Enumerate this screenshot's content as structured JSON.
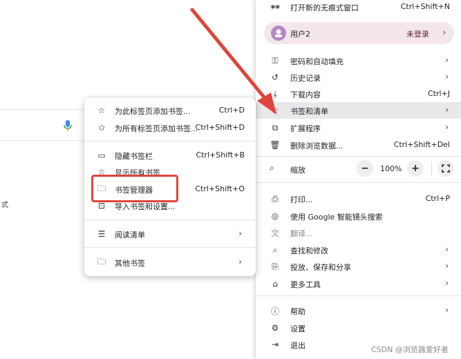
{
  "main_menu": {
    "incognito": {
      "label": "打开新的无痕式窗口",
      "shortcut": "Ctrl+Shift+N",
      "icon": "incognito-icon"
    },
    "profile": {
      "name": "用户2",
      "status": "未登录"
    },
    "items": [
      {
        "label": "密码和自动填充",
        "shortcut": "",
        "submenu": true,
        "icon": "key-icon"
      },
      {
        "label": "历史记录",
        "shortcut": "",
        "submenu": true,
        "icon": "history-icon"
      },
      {
        "label": "下载内容",
        "shortcut": "Ctrl+J",
        "submenu": false,
        "icon": "download-icon"
      },
      {
        "label": "书签和清单",
        "shortcut": "",
        "submenu": true,
        "icon": "star-icon"
      },
      {
        "label": "扩展程序",
        "shortcut": "",
        "submenu": true,
        "icon": "puzzle-icon"
      },
      {
        "label": "删除浏览数据...",
        "shortcut": "Ctrl+Shift+Del",
        "submenu": false,
        "icon": "trash-icon"
      }
    ],
    "zoom": {
      "label": "缩放",
      "minus": "−",
      "value": "100%",
      "plus": "+"
    },
    "items2": [
      {
        "label": "打印...",
        "shortcut": "Ctrl+P",
        "submenu": false,
        "icon": "print-icon"
      },
      {
        "label": "使用 Google 智能镜头搜索",
        "shortcut": "",
        "submenu": false,
        "icon": "lens-icon"
      },
      {
        "label": "翻译...",
        "shortcut": "",
        "submenu": false,
        "icon": "translate-icon"
      },
      {
        "label": "查找和修改",
        "shortcut": "",
        "submenu": true,
        "icon": "find-icon"
      },
      {
        "label": "投放、保存和分享",
        "shortcut": "",
        "submenu": true,
        "icon": "cast-icon"
      },
      {
        "label": "更多工具",
        "shortcut": "",
        "submenu": true,
        "icon": "toolbox-icon"
      }
    ],
    "items3": [
      {
        "label": "帮助",
        "shortcut": "",
        "submenu": true,
        "icon": "help-icon"
      },
      {
        "label": "设置",
        "shortcut": "",
        "submenu": false,
        "icon": "gear-icon"
      },
      {
        "label": "退出",
        "shortcut": "",
        "submenu": false,
        "icon": "exit-icon"
      }
    ]
  },
  "bookmarks_submenu": {
    "items": [
      {
        "label": "为此标签页添加书签...",
        "shortcut": "Ctrl+D",
        "icon": "star-icon"
      },
      {
        "label": "为所有标签页添加书签...",
        "shortcut": "Ctrl+Shift+D",
        "icon": "star-plus-icon"
      },
      {
        "label": "隐藏书签栏",
        "shortcut": "Ctrl+Shift+B",
        "icon": "window-icon"
      },
      {
        "label": "显示所有书签",
        "shortcut": "",
        "icon": "star-icon"
      },
      {
        "label": "书签管理器",
        "shortcut": "Ctrl+Shift+O",
        "icon": "folder-icon"
      },
      {
        "label": "导入书签和设置...",
        "shortcut": "",
        "icon": "import-icon"
      },
      {
        "label": "阅读清单",
        "shortcut": "",
        "icon": "list-icon",
        "submenu": true
      },
      {
        "label": "其他书签",
        "shortcut": "",
        "icon": "folder-icon",
        "submenu": true
      }
    ]
  },
  "background": {
    "left_char": "式"
  },
  "watermark": "CSDN @浏览器爱好者",
  "colors": {
    "highlight": "#e9e9ec",
    "profile_bg": "#f3e7ec",
    "annotation": "#e0443c"
  }
}
